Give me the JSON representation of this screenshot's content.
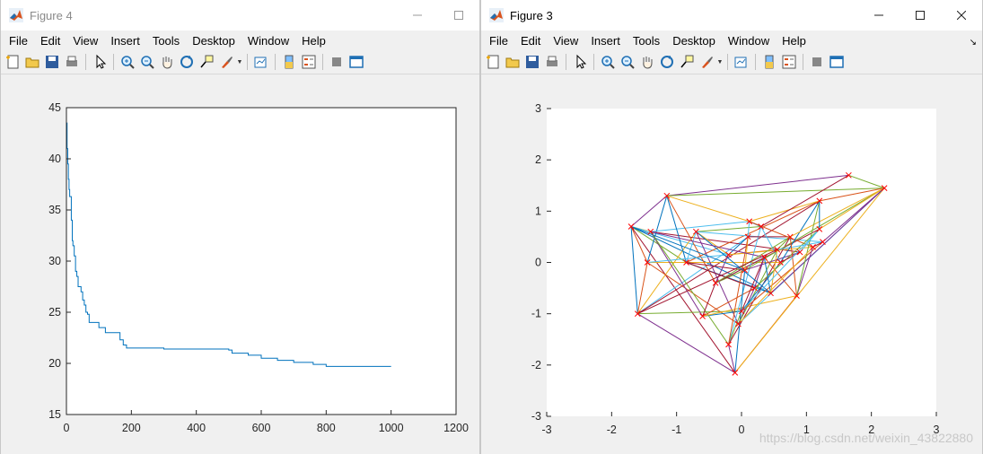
{
  "figure4": {
    "title": "Figure 4",
    "menu": [
      "File",
      "Edit",
      "View",
      "Insert",
      "Tools",
      "Desktop",
      "Window",
      "Help"
    ],
    "win_buttons": [
      "minimize-button",
      "maximize-button"
    ]
  },
  "figure3": {
    "title": "Figure 3",
    "menu": [
      "File",
      "Edit",
      "View",
      "Insert",
      "Tools",
      "Desktop",
      "Window",
      "Help"
    ],
    "win_buttons": [
      "minimize-button",
      "maximize-button",
      "close-button"
    ]
  },
  "watermark": "https://blog.csdn.net/weixin_43822880",
  "toolbar_icons": [
    "new-figure-icon",
    "open-file-icon",
    "save-icon",
    "print-icon",
    "sep",
    "pointer-icon",
    "sep",
    "zoom-in-icon",
    "zoom-out-icon",
    "pan-hand-icon",
    "rotate-3d-icon",
    "data-cursor-icon",
    "brush-icon",
    "dropdown-arrow-icon",
    "sep",
    "link-plot-icon",
    "sep",
    "insert-colorbar-icon",
    "insert-legend-icon",
    "sep",
    "hide-plot-tools-icon",
    "show-plot-tools-icon"
  ],
  "colors": {
    "line_blue": "#0072bd",
    "marker_red": "#ff0000",
    "palette": [
      "#0072bd",
      "#d95319",
      "#edb120",
      "#7e2f8e",
      "#77ac30",
      "#4dbeee",
      "#a2142f"
    ]
  },
  "chart_data": [
    {
      "type": "line",
      "title": "",
      "xlabel": "",
      "ylabel": "",
      "xlim": [
        0,
        1200
      ],
      "ylim": [
        15,
        45
      ],
      "xticks": [
        0,
        200,
        400,
        600,
        800,
        1000,
        1200
      ],
      "yticks": [
        15,
        20,
        25,
        30,
        35,
        40,
        45
      ],
      "grid": false,
      "series": [
        {
          "x": [
            1,
            2,
            4,
            6,
            8,
            10,
            12,
            15,
            18,
            20,
            24,
            28,
            32,
            36,
            40,
            45,
            50,
            55,
            60,
            65,
            70,
            78,
            85,
            100,
            120,
            140,
            165,
            175,
            185,
            200,
            300,
            400,
            500,
            510,
            560,
            600,
            650,
            700,
            760,
            800,
            1000
          ],
          "y": [
            43.5,
            41,
            39.5,
            38,
            37,
            36.3,
            36.3,
            34,
            32,
            31.5,
            30.5,
            29,
            28.5,
            27.5,
            27.5,
            27,
            26.2,
            25.7,
            25,
            24.8,
            24,
            24,
            24,
            23.5,
            23,
            23,
            22.3,
            21.8,
            21.5,
            21.5,
            21.4,
            21.4,
            21.3,
            21,
            20.8,
            20.5,
            20.3,
            20.1,
            19.9,
            19.7,
            19.7
          ]
        }
      ]
    },
    {
      "type": "scatter",
      "title": "",
      "xlabel": "",
      "ylabel": "",
      "xlim": [
        -3,
        3
      ],
      "ylim": [
        -3,
        3
      ],
      "xticks": [
        -3,
        -2,
        -1,
        0,
        1,
        2,
        3
      ],
      "yticks": [
        -3,
        -2,
        -1,
        0,
        1,
        2,
        3
      ],
      "grid": false,
      "points": [
        [
          -1.7,
          0.7
        ],
        [
          -1.6,
          -1.0
        ],
        [
          -1.45,
          0.0
        ],
        [
          -1.4,
          0.6
        ],
        [
          -1.15,
          1.3
        ],
        [
          -0.85,
          0.0
        ],
        [
          -0.7,
          0.6
        ],
        [
          -0.6,
          -1.05
        ],
        [
          -0.4,
          -0.4
        ],
        [
          -0.2,
          0.15
        ],
        [
          -0.2,
          -1.6
        ],
        [
          -0.1,
          -2.15
        ],
        [
          -0.05,
          -1.2
        ],
        [
          0.0,
          -0.95
        ],
        [
          0.05,
          -0.15
        ],
        [
          0.1,
          0.5
        ],
        [
          0.12,
          0.8
        ],
        [
          0.2,
          -0.5
        ],
        [
          0.3,
          0.7
        ],
        [
          0.35,
          0.1
        ],
        [
          0.45,
          -0.6
        ],
        [
          0.55,
          0.25
        ],
        [
          0.6,
          0.0
        ],
        [
          0.75,
          0.5
        ],
        [
          0.85,
          -0.65
        ],
        [
          0.9,
          0.2
        ],
        [
          1.1,
          0.3
        ],
        [
          1.2,
          1.2
        ],
        [
          1.2,
          0.65
        ],
        [
          1.25,
          0.4
        ],
        [
          1.65,
          1.7
        ],
        [
          2.2,
          1.45
        ]
      ],
      "edges": [
        [
          0,
          1
        ],
        [
          0,
          2
        ],
        [
          0,
          3
        ],
        [
          0,
          4
        ],
        [
          0,
          5
        ],
        [
          0,
          9
        ],
        [
          0,
          11
        ],
        [
          0,
          20
        ],
        [
          1,
          2
        ],
        [
          1,
          6
        ],
        [
          1,
          11
        ],
        [
          1,
          13
        ],
        [
          1,
          15
        ],
        [
          1,
          27
        ],
        [
          2,
          4
        ],
        [
          2,
          12
        ],
        [
          2,
          22
        ],
        [
          3,
          7
        ],
        [
          3,
          10
        ],
        [
          3,
          16
        ],
        [
          3,
          25
        ],
        [
          4,
          5
        ],
        [
          4,
          8
        ],
        [
          4,
          16
        ],
        [
          4,
          30
        ],
        [
          4,
          31
        ],
        [
          5,
          6
        ],
        [
          5,
          14
        ],
        [
          5,
          20
        ],
        [
          5,
          27
        ],
        [
          6,
          9
        ],
        [
          6,
          12
        ],
        [
          6,
          18
        ],
        [
          6,
          29
        ],
        [
          7,
          8
        ],
        [
          7,
          13
        ],
        [
          7,
          17
        ],
        [
          7,
          24
        ],
        [
          8,
          9
        ],
        [
          8,
          14
        ],
        [
          8,
          19
        ],
        [
          8,
          28
        ],
        [
          9,
          15
        ],
        [
          9,
          21
        ],
        [
          9,
          26
        ],
        [
          10,
          11
        ],
        [
          10,
          13
        ],
        [
          10,
          18
        ],
        [
          10,
          23
        ],
        [
          11,
          14
        ],
        [
          11,
          24
        ],
        [
          11,
          31
        ],
        [
          12,
          17
        ],
        [
          12,
          21
        ],
        [
          12,
          31
        ],
        [
          13,
          19
        ],
        [
          13,
          22
        ],
        [
          13,
          29
        ],
        [
          14,
          15
        ],
        [
          14,
          25
        ],
        [
          14,
          31
        ],
        [
          15,
          16
        ],
        [
          15,
          23
        ],
        [
          16,
          18
        ],
        [
          16,
          26
        ],
        [
          16,
          27
        ],
        [
          17,
          19
        ],
        [
          17,
          28
        ],
        [
          18,
          22
        ],
        [
          18,
          30
        ],
        [
          19,
          20
        ],
        [
          19,
          24
        ],
        [
          20,
          21
        ],
        [
          20,
          31
        ],
        [
          21,
          23
        ],
        [
          21,
          29
        ],
        [
          22,
          25
        ],
        [
          22,
          27
        ],
        [
          23,
          24
        ],
        [
          23,
          31
        ],
        [
          24,
          26
        ],
        [
          24,
          27
        ],
        [
          25,
          28
        ],
        [
          26,
          29
        ],
        [
          27,
          28
        ],
        [
          27,
          31
        ],
        [
          28,
          31
        ],
        [
          29,
          31
        ],
        [
          30,
          31
        ],
        [
          2,
          9
        ],
        [
          5,
          17
        ],
        [
          6,
          20
        ],
        [
          10,
          15
        ],
        [
          12,
          26
        ],
        [
          3,
          19
        ],
        [
          8,
          23
        ],
        [
          13,
          28
        ],
        [
          1,
          21
        ],
        [
          0,
          14
        ]
      ]
    }
  ]
}
